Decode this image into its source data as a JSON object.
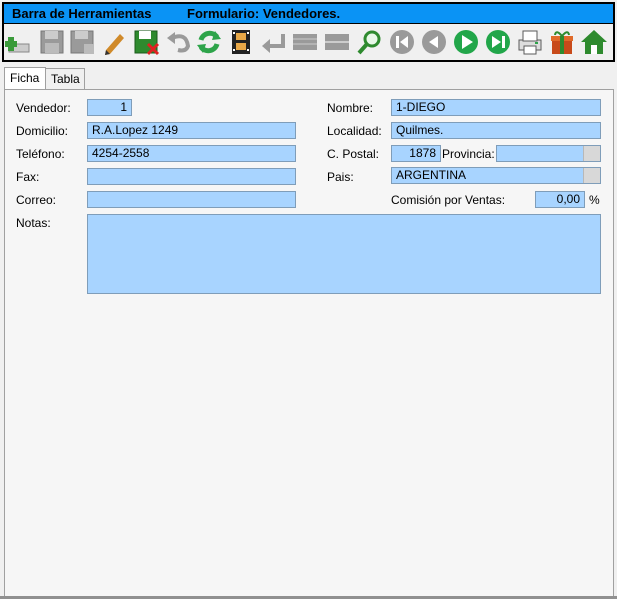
{
  "header": {
    "title_left": "Barra de Herramientas",
    "title_right": "Formulario: Vendedores."
  },
  "toolbar": {
    "icons": [
      {
        "name": "add-icon",
        "color": "#3a9a3a",
        "enabled": true
      },
      {
        "name": "save-icon",
        "color": "#9a9a9a",
        "enabled": false
      },
      {
        "name": "save-as-icon",
        "color": "#9a9a9a",
        "enabled": false
      },
      {
        "name": "edit-icon",
        "color": "#d08a2a",
        "enabled": true
      },
      {
        "name": "delete-icon",
        "color": "#2e8a2e",
        "enabled": true
      },
      {
        "name": "undo-icon",
        "color": "#9a9a9a",
        "enabled": false
      },
      {
        "name": "refresh-icon",
        "color": "#2ea44a",
        "enabled": true
      },
      {
        "name": "film-icon",
        "color": "#8a5a20",
        "enabled": true
      },
      {
        "name": "return-icon",
        "color": "#9a9a9a",
        "enabled": false
      },
      {
        "name": "grid-icon",
        "color": "#9a9a9a",
        "enabled": false
      },
      {
        "name": "grid-alt-icon",
        "color": "#9a9a9a",
        "enabled": false
      },
      {
        "name": "search-icon",
        "color": "#2e8a2e",
        "enabled": true
      },
      {
        "name": "first-record-icon",
        "color": "#9a9a9a",
        "enabled": false
      },
      {
        "name": "previous-record-icon",
        "color": "#9a9a9a",
        "enabled": false
      },
      {
        "name": "next-record-icon",
        "color": "#22a64a",
        "enabled": true
      },
      {
        "name": "last-record-icon",
        "color": "#22a64a",
        "enabled": true
      },
      {
        "name": "print-icon",
        "color": "#5a5a5a",
        "enabled": true
      },
      {
        "name": "gift-icon",
        "color": "#c84a1a",
        "enabled": true
      },
      {
        "name": "home-icon",
        "color": "#2e8a2e",
        "enabled": true
      }
    ]
  },
  "tabs": [
    {
      "label": "Ficha",
      "active": true
    },
    {
      "label": "Tabla",
      "active": false
    }
  ],
  "form": {
    "vendedor": {
      "label": "Vendedor:",
      "value": "1"
    },
    "domicilio": {
      "label": "Domicilio:",
      "value": "R.A.Lopez 1249"
    },
    "telefono": {
      "label": "Teléfono:",
      "value": "4254-2558"
    },
    "fax": {
      "label": "Fax:",
      "value": ""
    },
    "correo": {
      "label": "Correo:",
      "value": ""
    },
    "notas": {
      "label": "Notas:",
      "value": ""
    },
    "nombre": {
      "label": "Nombre:",
      "value": "1-DIEGO"
    },
    "localidad": {
      "label": "Localidad:",
      "value": "Quilmes."
    },
    "cpostal": {
      "label": "C. Postal:",
      "value": "1878"
    },
    "provincia": {
      "label": "Provincia:",
      "value": ""
    },
    "pais": {
      "label": "Pais:",
      "value": "ARGENTINA"
    },
    "comision": {
      "label": "Comisión por Ventas:",
      "value": "0,00",
      "unit": "%"
    }
  },
  "colors": {
    "title_bar": "#0a93f5",
    "field_bg": "#a8d4ff"
  }
}
